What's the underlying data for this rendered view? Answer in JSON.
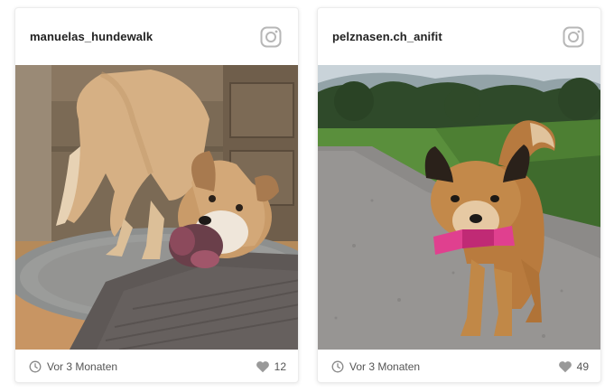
{
  "posts": [
    {
      "username": "manuelas_hundewalk",
      "time": "Vor 3 Monaten",
      "likes": "12",
      "platform_icon": "instagram-icon",
      "photo_subject": "dog-chewing-toy"
    },
    {
      "username": "pelznasen.ch_anifit",
      "time": "Vor 3 Monaten",
      "likes": "49",
      "platform_icon": "instagram-icon",
      "photo_subject": "dog-running-with-toy"
    }
  ],
  "colors": {
    "icon_gray": "#b7b7b7",
    "heart_gray": "#999999",
    "text_dark": "#222222",
    "text_meta": "#555555"
  }
}
